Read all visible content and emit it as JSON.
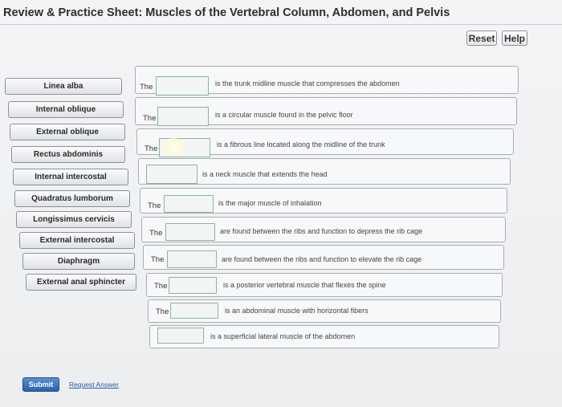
{
  "header": {
    "title": "Review & Practice Sheet: Muscles of the Vertebral Column, Abdomen, and Pelvis"
  },
  "toolbar": {
    "reset_label": "Reset",
    "help_label": "Help"
  },
  "labels": [
    "Linea alba",
    "Internal oblique",
    "External oblique",
    "Rectus abdominis",
    "Internal intercostal",
    "Quadratus lumborum",
    "Longissimus cervicis",
    "External intercostal",
    "Diaphragm",
    "External anal sphincter"
  ],
  "statements": [
    {
      "prefix": "The",
      "text": "is the trunk midline muscle that compresses the abdomen"
    },
    {
      "prefix": "The",
      "text": "is a circular muscle found in the pelvic floor"
    },
    {
      "prefix": "The",
      "text": "is a fibrous line located along the midline of the trunk"
    },
    {
      "prefix": "",
      "text": "is a neck muscle that extends the head"
    },
    {
      "prefix": "The",
      "text": "is the major muscle of inhalation"
    },
    {
      "prefix": "The",
      "text": "are found between the ribs and function to depress the rib cage"
    },
    {
      "prefix": "The",
      "text": "are found between the ribs and function to elevate the rib cage"
    },
    {
      "prefix": "The",
      "text": "is a posterior vertebral muscle that flexes the spine"
    },
    {
      "prefix": "The",
      "text": "is an abdominal muscle with horizontal fibers"
    },
    {
      "prefix": "",
      "text": "is a superficial lateral muscle of the abdomen"
    }
  ],
  "footer": {
    "submit_label": "Submit",
    "request_label": "Request Answer"
  }
}
